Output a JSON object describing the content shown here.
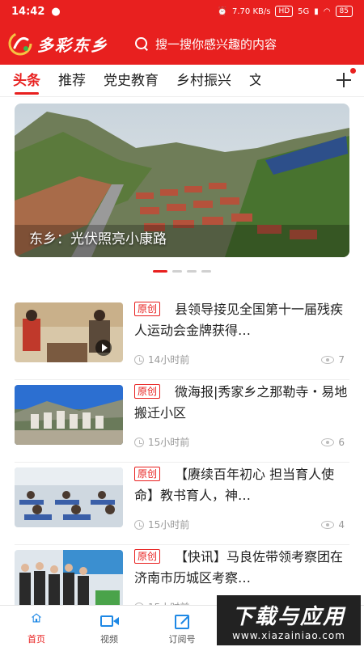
{
  "status_bar": {
    "time": "14:42",
    "network_speed": "7.70 KB/s",
    "hd_label": "HD",
    "signal_label": "5G",
    "battery": "85"
  },
  "header": {
    "app_name": "多彩东乡",
    "search_placeholder": "搜一搜你感兴趣的内容"
  },
  "tabs": [
    {
      "label": "头条",
      "active": true
    },
    {
      "label": "推荐",
      "active": false
    },
    {
      "label": "党史教育",
      "active": false
    },
    {
      "label": "乡村振兴",
      "active": false
    },
    {
      "label": "文",
      "active": false
    }
  ],
  "banner": {
    "caption": "东乡：光伏照亮小康路",
    "slide_count": 4,
    "active_slide": 0
  },
  "news": [
    {
      "badge": "原创",
      "title": "县领导接见全国第十一届残疾人运动会金牌获得…",
      "time": "14小时前",
      "views": "7",
      "has_video": true
    },
    {
      "badge": "原创",
      "title": "微海报|秀家乡之那勒寺・易地搬迁小区",
      "time": "15小时前",
      "views": "6",
      "has_video": false
    },
    {
      "badge": "原创",
      "title": "【赓续百年初心  担当育人使命】教书育人，神…",
      "time": "15小时前",
      "views": "4",
      "has_video": false
    },
    {
      "badge": "原创",
      "title": "【快讯】马良佐带领考察团在济南市历城区考察…",
      "time": "15小时前",
      "views": "",
      "has_video": false
    }
  ],
  "bottom_nav": [
    {
      "label": "首页",
      "icon": "home-icon",
      "active": true
    },
    {
      "label": "视频",
      "icon": "video-icon",
      "active": false
    },
    {
      "label": "订阅号",
      "icon": "subscribe-icon",
      "active": false
    }
  ],
  "watermark": {
    "big": "下载与应用",
    "small": "www.xiazainiao.com"
  },
  "colors": {
    "brand_red": "#e8201f",
    "nav_blue": "#1e88e5"
  }
}
